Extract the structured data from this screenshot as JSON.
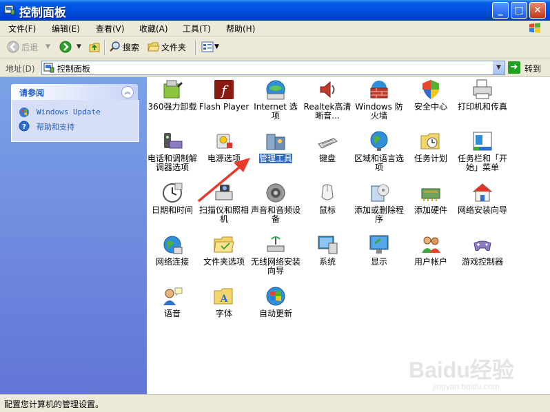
{
  "window": {
    "title": "控制面板"
  },
  "menu": [
    "文件(F)",
    "编辑(E)",
    "查看(V)",
    "收藏(A)",
    "工具(T)",
    "帮助(H)"
  ],
  "toolbar": {
    "back": "后退",
    "search": "搜索",
    "folders": "文件夹"
  },
  "address": {
    "label": "地址(D)",
    "value": "控制面板",
    "go": "转到"
  },
  "sidebar": {
    "title": "请参阅",
    "links": [
      "Windows Update",
      "帮助和支持"
    ]
  },
  "items": [
    {
      "label": "360强力卸载",
      "icon": "uninstall-icon"
    },
    {
      "label": "Flash Player",
      "icon": "flash-icon"
    },
    {
      "label": "Internet 选项",
      "icon": "internet-options-icon"
    },
    {
      "label": "Realtek高清晰音...",
      "icon": "speaker-icon"
    },
    {
      "label": "Windows 防火墙",
      "icon": "firewall-icon"
    },
    {
      "label": "安全中心",
      "icon": "shield-icon"
    },
    {
      "label": "打印机和传真",
      "icon": "printer-icon"
    },
    {
      "label": "电话和调制解调器选项",
      "icon": "phone-modem-icon"
    },
    {
      "label": "电源选项",
      "icon": "power-icon"
    },
    {
      "label": "管理工具",
      "icon": "admin-tools-icon"
    },
    {
      "label": "键盘",
      "icon": "keyboard-icon"
    },
    {
      "label": "区域和语言选项",
      "icon": "globe-icon"
    },
    {
      "label": "任务计划",
      "icon": "scheduled-tasks-icon"
    },
    {
      "label": "任务栏和「开始」菜单",
      "icon": "taskbar-icon"
    },
    {
      "label": "日期和时间",
      "icon": "clock-icon"
    },
    {
      "label": "扫描仪和照相机",
      "icon": "scanner-camera-icon"
    },
    {
      "label": "声音和音频设备",
      "icon": "sound-icon"
    },
    {
      "label": "鼠标",
      "icon": "mouse-icon"
    },
    {
      "label": "添加或删除程序",
      "icon": "add-remove-programs-icon"
    },
    {
      "label": "添加硬件",
      "icon": "add-hardware-icon"
    },
    {
      "label": "网络安装向导",
      "icon": "network-setup-icon"
    },
    {
      "label": "网络连接",
      "icon": "network-connections-icon"
    },
    {
      "label": "文件夹选项",
      "icon": "folder-options-icon"
    },
    {
      "label": "无线网络安装向导",
      "icon": "wireless-icon"
    },
    {
      "label": "系统",
      "icon": "system-icon"
    },
    {
      "label": "显示",
      "icon": "display-icon"
    },
    {
      "label": "用户帐户",
      "icon": "user-accounts-icon"
    },
    {
      "label": "游戏控制器",
      "icon": "game-controller-icon"
    },
    {
      "label": "语音",
      "icon": "speech-icon"
    },
    {
      "label": "字体",
      "icon": "fonts-icon"
    },
    {
      "label": "自动更新",
      "icon": "windows-update-icon"
    }
  ],
  "selected_item": "管理工具",
  "watermark": {
    "main": "Baidu经验",
    "sub": "jingyan.baidu.com"
  },
  "status": "配置您计算机的管理设置。",
  "colors": {
    "titlebar": "#0054e3",
    "sidebar": "#6375d6",
    "selection": "#316ac5",
    "arrow": "#e83a2a"
  }
}
